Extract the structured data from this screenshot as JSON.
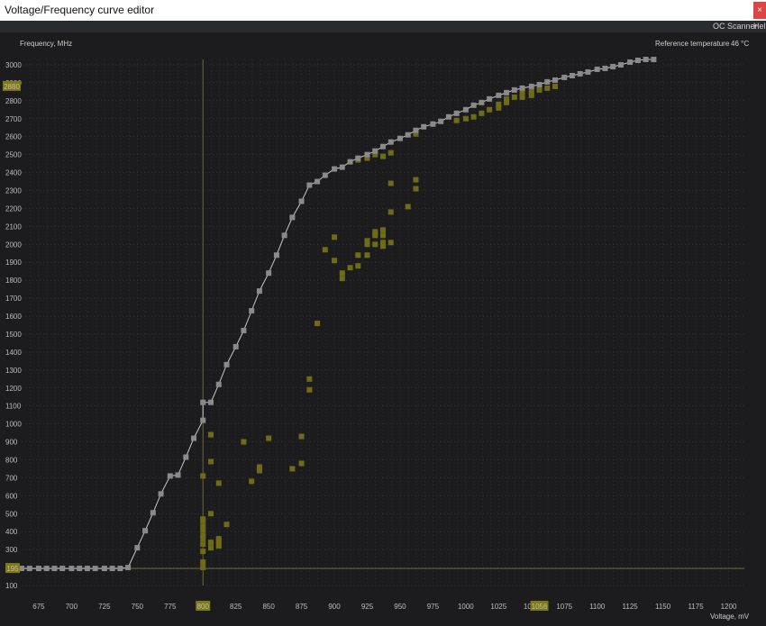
{
  "window": {
    "title": "Voltage/Frequency curve editor",
    "close_glyph": "×"
  },
  "menu": {
    "oc_scanner": "OC Scanner",
    "help": "Help"
  },
  "header": {
    "freq_label": "Frequency, MHz",
    "ref_temp_label": "Reference temperature",
    "ref_temp_value": "46 °C"
  },
  "colors": {
    "background": "#1c1c1e",
    "curve": "#8a8a8a",
    "curve_line": "#c8c8c8",
    "scan_points": "#6e6c17",
    "highlight": "#7d7a13",
    "grid": "#3a3a3c"
  },
  "chart_data": {
    "type": "line",
    "title": "",
    "xlabel": "Voltage, mV",
    "ylabel": "Frequency, MHz",
    "xlim": [
      662,
      1212
    ],
    "ylim": [
      100,
      3030
    ],
    "x_ticks": [
      675,
      700,
      725,
      750,
      775,
      800,
      825,
      850,
      875,
      900,
      925,
      950,
      975,
      1000,
      1025,
      1050,
      1075,
      1100,
      1125,
      1150,
      1175,
      1200
    ],
    "y_ticks": [
      100,
      200,
      300,
      400,
      500,
      600,
      700,
      800,
      900,
      1000,
      1100,
      1200,
      1300,
      1400,
      1500,
      1600,
      1700,
      1800,
      1900,
      2000,
      2100,
      2200,
      2300,
      2400,
      2500,
      2600,
      2700,
      2800,
      2900,
      3000
    ],
    "highlight_x": 800,
    "highlight_x_label": "800",
    "highlight_x2": 1056,
    "highlight_x2_label": "1056",
    "highlight_y": 195,
    "highlight_y_label": "195",
    "highlight_y2": 2880,
    "highlight_y2_label": "2880",
    "series": [
      {
        "values": [
          [
            662,
            195
          ],
          [
            668,
            195
          ],
          [
            675,
            195
          ],
          [
            681,
            195
          ],
          [
            687,
            195
          ],
          [
            693,
            195
          ],
          [
            700,
            195
          ],
          [
            706,
            195
          ],
          [
            712,
            195
          ],
          [
            718,
            195
          ],
          [
            725,
            195
          ],
          [
            731,
            195
          ],
          [
            737,
            195
          ],
          [
            743,
            200
          ],
          [
            750,
            310
          ],
          [
            756,
            405
          ],
          [
            762,
            505
          ],
          [
            768,
            610
          ],
          [
            775,
            710
          ],
          [
            781,
            715
          ],
          [
            787,
            815
          ],
          [
            793,
            920
          ],
          [
            800,
            1020
          ],
          [
            800,
            1120
          ],
          [
            806,
            1120
          ],
          [
            812,
            1220
          ],
          [
            818,
            1330
          ],
          [
            825,
            1430
          ],
          [
            831,
            1520
          ],
          [
            837,
            1630
          ],
          [
            843,
            1740
          ],
          [
            850,
            1840
          ],
          [
            856,
            1940
          ],
          [
            862,
            2050
          ],
          [
            868,
            2150
          ],
          [
            875,
            2240
          ],
          [
            881,
            2330
          ],
          [
            887,
            2350
          ],
          [
            893,
            2385
          ],
          [
            900,
            2420
          ],
          [
            906,
            2430
          ],
          [
            912,
            2460
          ],
          [
            918,
            2480
          ],
          [
            925,
            2500
          ],
          [
            931,
            2520
          ],
          [
            937,
            2545
          ],
          [
            943,
            2570
          ],
          [
            950,
            2590
          ],
          [
            956,
            2610
          ],
          [
            962,
            2635
          ],
          [
            968,
            2655
          ],
          [
            975,
            2670
          ],
          [
            981,
            2685
          ],
          [
            987,
            2710
          ],
          [
            993,
            2730
          ],
          [
            1000,
            2750
          ],
          [
            1006,
            2775
          ],
          [
            1012,
            2790
          ],
          [
            1018,
            2810
          ],
          [
            1025,
            2830
          ],
          [
            1031,
            2845
          ],
          [
            1037,
            2860
          ],
          [
            1043,
            2870
          ],
          [
            1050,
            2880
          ],
          [
            1056,
            2890
          ],
          [
            1062,
            2905
          ],
          [
            1068,
            2915
          ],
          [
            1075,
            2930
          ],
          [
            1081,
            2940
          ],
          [
            1087,
            2950
          ],
          [
            1093,
            2960
          ],
          [
            1100,
            2975
          ],
          [
            1106,
            2980
          ],
          [
            1112,
            2990
          ],
          [
            1118,
            3000
          ],
          [
            1125,
            3015
          ],
          [
            1131,
            3025
          ],
          [
            1137,
            3030
          ],
          [
            1143,
            3030
          ]
        ]
      },
      {
        "values": [
          [
            800,
            200
          ],
          [
            800,
            230
          ],
          [
            800,
            290
          ],
          [
            800,
            330
          ],
          [
            800,
            360
          ],
          [
            800,
            380
          ],
          [
            800,
            410
          ],
          [
            800,
            430
          ],
          [
            800,
            460
          ],
          [
            800,
            470
          ],
          [
            800,
            710
          ],
          [
            806,
            500
          ],
          [
            806,
            310
          ],
          [
            806,
            340
          ],
          [
            806,
            940
          ],
          [
            806,
            790
          ],
          [
            812,
            320
          ],
          [
            812,
            330
          ],
          [
            812,
            350
          ],
          [
            812,
            360
          ],
          [
            812,
            670
          ],
          [
            818,
            440
          ],
          [
            831,
            900
          ],
          [
            837,
            680
          ],
          [
            843,
            740
          ],
          [
            843,
            760
          ],
          [
            850,
            920
          ],
          [
            868,
            750
          ],
          [
            875,
            930
          ],
          [
            875,
            780
          ],
          [
            881,
            1190
          ],
          [
            881,
            1250
          ],
          [
            887,
            1560
          ],
          [
            893,
            1970
          ],
          [
            900,
            1910
          ],
          [
            900,
            2040
          ],
          [
            906,
            1810
          ],
          [
            906,
            1840
          ],
          [
            912,
            1870
          ],
          [
            918,
            1880
          ],
          [
            918,
            1940
          ],
          [
            925,
            1940
          ],
          [
            925,
            2000
          ],
          [
            925,
            2020
          ],
          [
            931,
            2050
          ],
          [
            931,
            2060
          ],
          [
            931,
            2000
          ],
          [
            931,
            2070
          ],
          [
            937,
            1990
          ],
          [
            937,
            2010
          ],
          [
            937,
            2050
          ],
          [
            937,
            2080
          ],
          [
            943,
            2010
          ],
          [
            943,
            2180
          ],
          [
            943,
            2340
          ],
          [
            956,
            2210
          ],
          [
            962,
            2310
          ],
          [
            962,
            2360
          ],
          [
            918,
            2470
          ],
          [
            925,
            2480
          ],
          [
            931,
            2500
          ],
          [
            937,
            2490
          ],
          [
            943,
            2510
          ],
          [
            962,
            2615
          ],
          [
            993,
            2690
          ],
          [
            1000,
            2700
          ],
          [
            1006,
            2710
          ],
          [
            1012,
            2730
          ],
          [
            1018,
            2750
          ],
          [
            1025,
            2760
          ],
          [
            1031,
            2790
          ],
          [
            1037,
            2820
          ],
          [
            1043,
            2840
          ],
          [
            1050,
            2850
          ],
          [
            1056,
            2860
          ],
          [
            1062,
            2870
          ],
          [
            1068,
            2880
          ],
          [
            1031,
            2810
          ],
          [
            1025,
            2780
          ],
          [
            1043,
            2820
          ],
          [
            1050,
            2830
          ]
        ]
      }
    ]
  }
}
